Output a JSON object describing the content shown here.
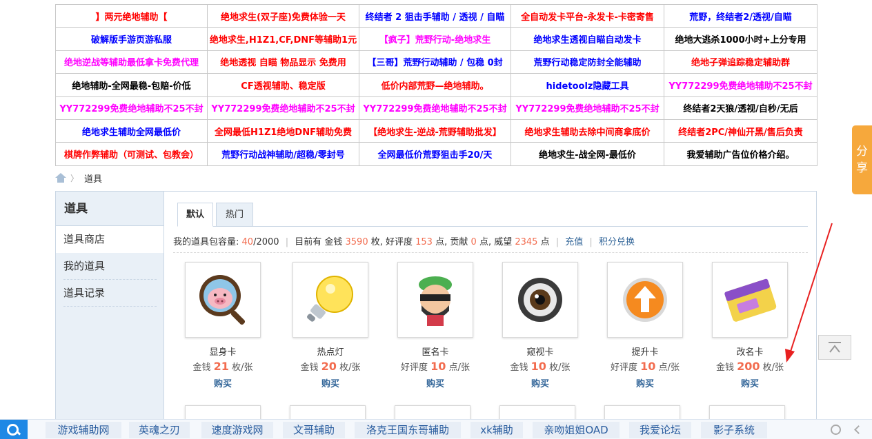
{
  "ads": [
    [
      {
        "text": "】两元绝地辅助【",
        "color": "red"
      },
      {
        "text": "绝地求生(双子座)免费体验一天",
        "color": "red"
      },
      {
        "text": "终结者 2 狙击手辅助 / 透视 / 自瞄",
        "color": "blue"
      },
      {
        "text": "全自动发卡平台-永发卡-卡密寄售",
        "color": "red"
      },
      {
        "text": "荒野，终结者2/透视/自瞄",
        "color": "blue"
      }
    ],
    [
      {
        "text": "破解版手游页游私服",
        "color": "blue"
      },
      {
        "text": "绝地求生,H1Z1,CF,DNF等辅助1元",
        "color": "red"
      },
      {
        "text": "【疯子】荒野行动-绝地求生",
        "color": "mag"
      },
      {
        "text": "绝地求生透视自瞄自动发卡",
        "color": "blue"
      },
      {
        "text": "绝地大逃杀1000小时+上分专用",
        "color": "blk"
      }
    ],
    [
      {
        "text": "绝地逆战等辅助最低拿卡免费代理",
        "color": "mag"
      },
      {
        "text": "绝地透视 自瞄 物品显示 免费用",
        "color": "red"
      },
      {
        "text": "【三哥】荒野行动辅助 / 包稳 0封",
        "color": "blue"
      },
      {
        "text": "荒野行动稳定防封全能辅助",
        "color": "blue"
      },
      {
        "text": "绝地子弹追踪稳定辅助群",
        "color": "red"
      }
    ],
    [
      {
        "text": "绝地辅助-全网最稳-包赔-价低",
        "color": "blk"
      },
      {
        "text": "CF透视辅助、稳定版",
        "color": "red"
      },
      {
        "text": "低价内部荒野—绝地辅助。",
        "color": "red"
      },
      {
        "text": "hidetoolz隐藏工具",
        "color": "blue"
      },
      {
        "text": "YY772299免费绝地辅助不25不封",
        "color": "mag"
      }
    ],
    [
      {
        "text": "YY772299免费绝地辅助不25不封",
        "color": "mag"
      },
      {
        "text": "YY772299免费绝地辅助不25不封",
        "color": "mag"
      },
      {
        "text": "YY772299免费绝地辅助不25不封",
        "color": "mag"
      },
      {
        "text": "YY772299免费绝地辅助不25不封",
        "color": "mag"
      },
      {
        "text": "终结者2天狼/透视/自秒/无后",
        "color": "blk"
      }
    ],
    [
      {
        "text": "绝地求生辅助全网最低价",
        "color": "blue"
      },
      {
        "text": "全网最低H1Z1绝地DNF辅助免费",
        "color": "red"
      },
      {
        "text": "【绝地求生-逆战-荒野辅助批发】",
        "color": "red"
      },
      {
        "text": "绝地求生辅助去除中间商拿底价",
        "color": "red"
      },
      {
        "text": "终结者2PC/神仙开黑/售后负责",
        "color": "red"
      }
    ],
    [
      {
        "text": "棋牌作弊辅助（可测试、包教会）",
        "color": "red"
      },
      {
        "text": "荒野行动战神辅助/超稳/零封号",
        "color": "blue"
      },
      {
        "text": "全网最低价荒野狙击手20/天",
        "color": "blue"
      },
      {
        "text": "绝地求生-战全网-最低价",
        "color": "blk"
      },
      {
        "text": "我爱辅助广告位价格介绍。",
        "color": "blk"
      }
    ]
  ],
  "breadcrumb": {
    "current": "道具",
    "separator": "〉"
  },
  "sidebar": {
    "title": "道具",
    "items": [
      {
        "label": "道具商店"
      },
      {
        "label": "我的道具"
      },
      {
        "label": "道具记录"
      }
    ]
  },
  "tabs": [
    {
      "label": "默认"
    },
    {
      "label": "热门"
    }
  ],
  "stats": {
    "capacity_label": "我的道具包容量:",
    "capacity_used": "40",
    "capacity_total": "/2000",
    "current_label": "目前有 金钱",
    "money": "3590",
    "money_unit": "枚, 好评度",
    "rating": "153",
    "rating_unit": "点, 贡献",
    "contrib": "0",
    "contrib_unit": "点, 威望",
    "prestige": "2345",
    "prestige_unit": "点",
    "recharge": "充值",
    "exchange": "积分兑换"
  },
  "items": [
    {
      "name": "显身卡",
      "currency": "金钱",
      "price": "21",
      "unit": "枚/张",
      "buy": "购买",
      "icon": "pig-magnifier-icon"
    },
    {
      "name": "热点灯",
      "currency": "金钱",
      "price": "20",
      "unit": "枚/张",
      "buy": "购买",
      "icon": "light-bulb-icon"
    },
    {
      "name": "匿名卡",
      "currency": "好评度",
      "price": "10",
      "unit": "点/张",
      "buy": "购买",
      "icon": "masked-face-icon"
    },
    {
      "name": "窥视卡",
      "currency": "金钱",
      "price": "10",
      "unit": "枚/张",
      "buy": "购买",
      "icon": "eye-icon"
    },
    {
      "name": "提升卡",
      "currency": "好评度",
      "price": "10",
      "unit": "点/张",
      "buy": "购买",
      "icon": "up-arrow-icon"
    },
    {
      "name": "改名卡",
      "currency": "金钱",
      "price": "200",
      "unit": "枚/张",
      "buy": "购买",
      "icon": "rename-card-icon"
    }
  ],
  "share": {
    "label": "分享"
  },
  "bottom_links": [
    {
      "label": "游戏辅助网"
    },
    {
      "label": "英魂之刃"
    },
    {
      "label": "速度游戏网"
    },
    {
      "label": "文哥辅助"
    },
    {
      "label": "洛克王国东哥辅助"
    },
    {
      "label": "xk辅助"
    },
    {
      "label": "亲吻姐姐OAD"
    },
    {
      "label": "我爱论坛"
    },
    {
      "label": "影子系统"
    }
  ],
  "colors": {
    "accent_orange": "#f6a83c",
    "number": "#f26c4f",
    "link": "#336699",
    "panel_bg": "#e9f0f7"
  }
}
